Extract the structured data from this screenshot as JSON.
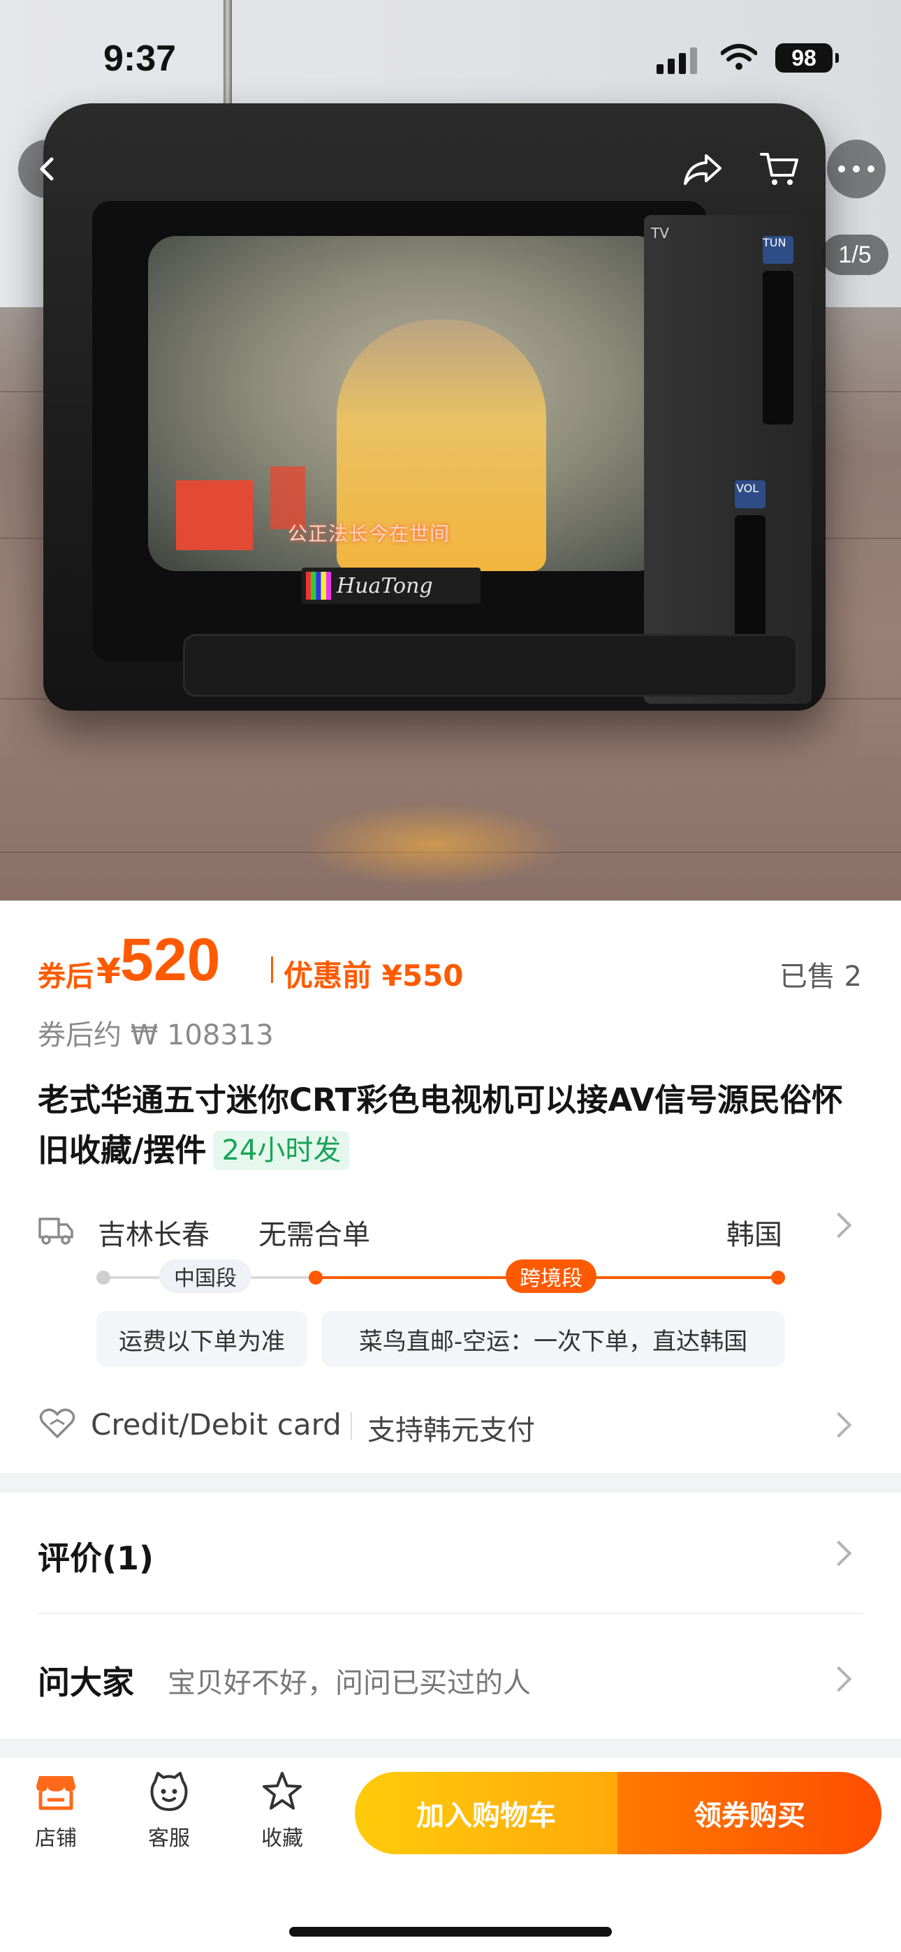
{
  "status_bar": {
    "time": "9:37",
    "battery": "98"
  },
  "gallery": {
    "page_indicator": "1/5",
    "tv_brand": "HuaTong",
    "tv_label": "TV",
    "tun_label": "TUN",
    "vol_label": "VOL",
    "screen_subtitle": "公正法长今在世间"
  },
  "price": {
    "after_label": "券后",
    "currency": "¥",
    "after_value": "520",
    "before_label": "优惠前 ¥550",
    "sold": "已售 2",
    "approx": "券后约 ₩ 108313"
  },
  "product": {
    "title": "老式华通五寸迷你CRT彩色电视机可以接AV信号源民俗怀旧收藏/摆件",
    "badge": "24小时发"
  },
  "logistics": {
    "origin": "吉林长春",
    "merge": "无需合单",
    "destination": "韩国",
    "segment_domestic": "中国段",
    "segment_cross": "跨境段",
    "domestic_note": "运费以下单为准",
    "cross_note": "菜鸟直邮-空运：一次下单，直达韩国"
  },
  "payment": {
    "method": "Credit/Debit card",
    "note": "支持韩元支付"
  },
  "reviews": {
    "title": "评价(1)"
  },
  "ask": {
    "title": "问大家",
    "subtitle": "宝贝好不好，问问已买过的人"
  },
  "bottom_bar": {
    "tabs": [
      {
        "label": "店铺",
        "icon": "store-icon"
      },
      {
        "label": "客服",
        "icon": "customer-service-icon"
      },
      {
        "label": "收藏",
        "icon": "star-icon"
      }
    ],
    "add_to_cart": "加入购物车",
    "buy_with_coupon": "领券购买"
  },
  "colors": {
    "accent": "#ff5a00",
    "cart_button": "#ffb60a",
    "badge_green": "#19a356"
  }
}
